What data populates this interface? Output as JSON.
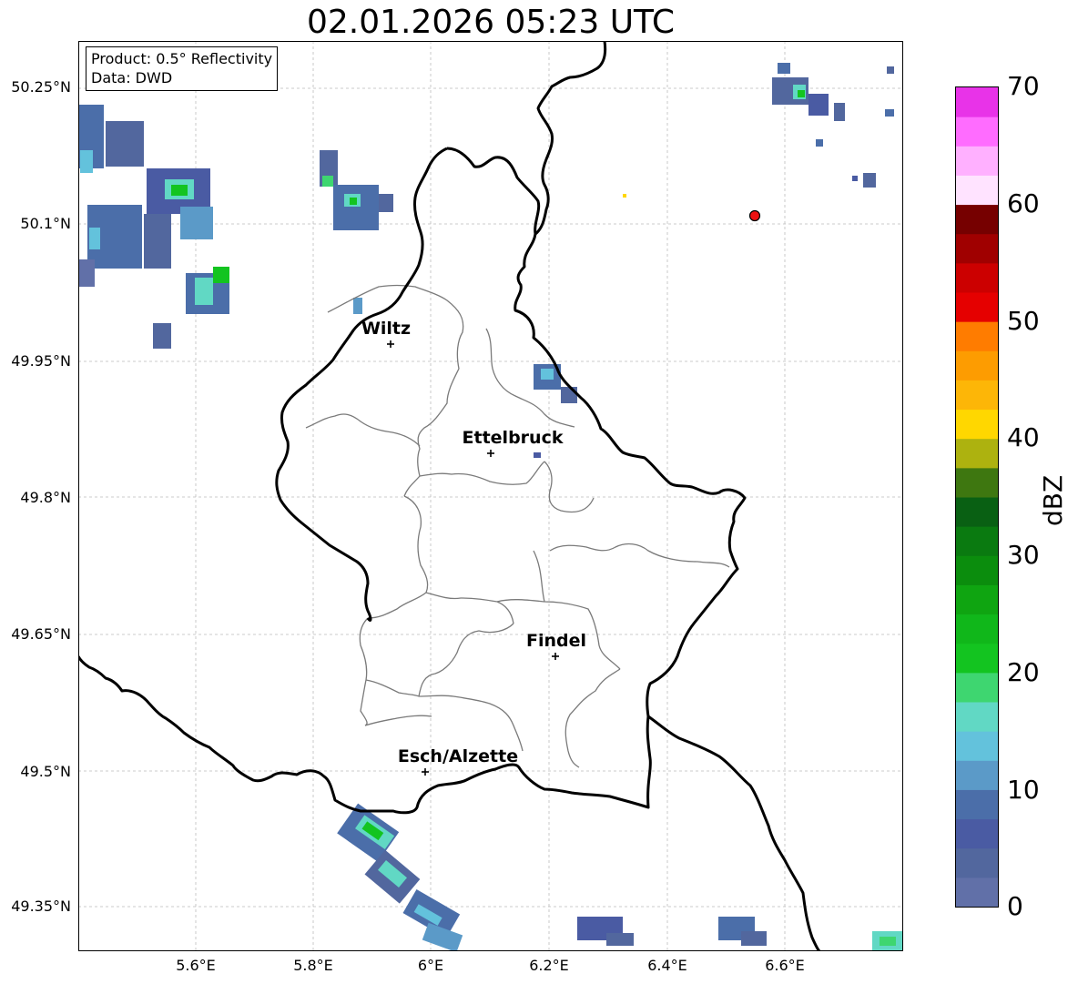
{
  "title": "02.01.2026 05:23 UTC",
  "info": {
    "product": "Product: 0.5° Reflectivity",
    "data": "Data: DWD"
  },
  "axes": {
    "lat_labels": [
      "50.25°N",
      "50.1°N",
      "49.95°N",
      "49.8°N",
      "49.65°N",
      "49.5°N",
      "49.35°N"
    ],
    "lon_labels": [
      "5.6°E",
      "5.8°E",
      "6°E",
      "6.2°E",
      "6.4°E",
      "6.6°E"
    ]
  },
  "cities": [
    {
      "name": "Wiltz",
      "lat": 49.967,
      "lon": 5.933
    },
    {
      "name": "Ettelbruck",
      "lat": 49.848,
      "lon": 6.103
    },
    {
      "name": "Findel",
      "lat": 49.626,
      "lon": 6.212
    },
    {
      "name": "Esch/Alzette",
      "lat": 49.497,
      "lon": 5.983
    }
  ],
  "radar_site": {
    "lat": 50.111,
    "lon": 6.548
  },
  "colorbar": {
    "label": "dBZ",
    "ticks": [
      "0",
      "10",
      "20",
      "30",
      "40",
      "50",
      "60",
      "70"
    ],
    "colors": [
      "#6170a8",
      "#52679e",
      "#4a5ba3",
      "#4b6ea9",
      "#5b9ac8",
      "#63c2dc",
      "#61d8c4",
      "#3ed670",
      "#13c420",
      "#10b71a",
      "#0fa511",
      "#0b8d0d",
      "#0a7a10",
      "#096013",
      "#3e7710",
      "#adb20f",
      "#ffd700",
      "#fdb607",
      "#fd9c01",
      "#ff7c00",
      "#e50000",
      "#cc0000",
      "#a00000",
      "#760000",
      "#ffe3ff",
      "#ffb0ff",
      "#ff6cff",
      "#e833e8"
    ]
  }
}
